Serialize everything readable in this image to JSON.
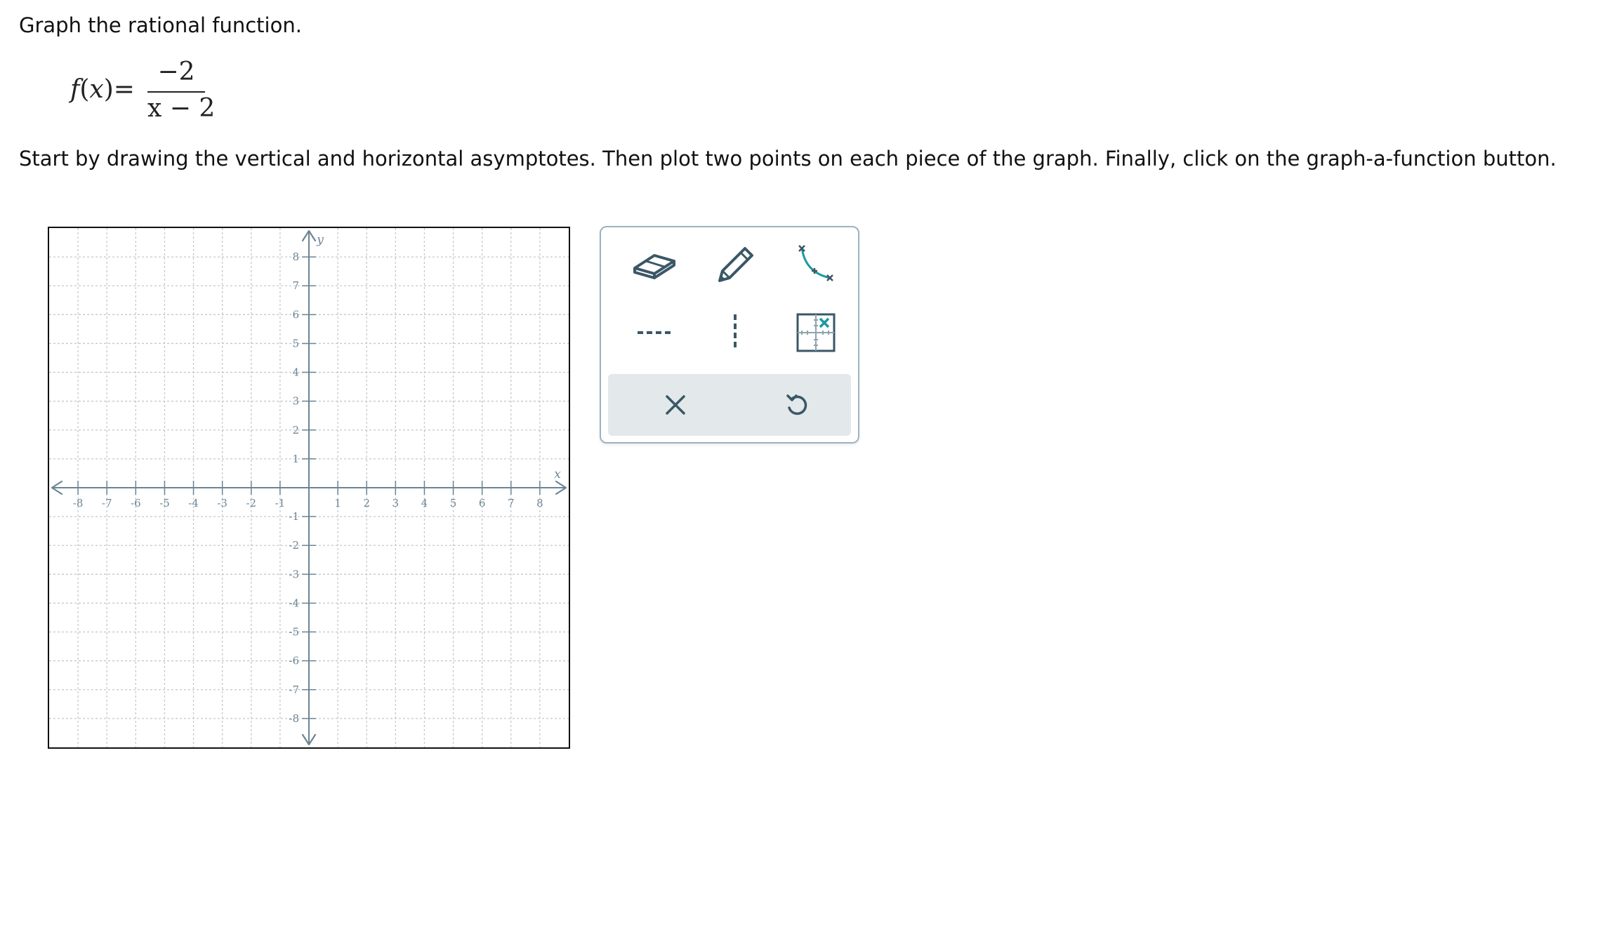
{
  "question": {
    "prompt": "Graph the rational function.",
    "function": {
      "name": "f",
      "variable": "x",
      "equals": "=",
      "numerator": "−2",
      "denominator": "x − 2"
    },
    "directions": "Start by drawing the vertical and horizontal asymptotes. Then plot two points on each piece of the graph. Finally, click on the graph-a-function button."
  },
  "graph": {
    "x_axis_label": "x",
    "y_axis_label": "y",
    "x_range": [
      -9,
      9
    ],
    "y_range": [
      -9,
      9
    ],
    "x_tick_labels": [
      "-8",
      "-7",
      "-6",
      "-5",
      "-4",
      "-3",
      "-2",
      "-1",
      "1",
      "2",
      "3",
      "4",
      "5",
      "6",
      "7",
      "8"
    ],
    "y_tick_labels": [
      "8",
      "7",
      "6",
      "5",
      "4",
      "3",
      "2",
      "1",
      "-1",
      "-2",
      "-3",
      "-4",
      "-5",
      "-6",
      "-7",
      "-8"
    ],
    "grid": true,
    "colors": {
      "axis": "#6c8494",
      "grid": "#c4c9cc",
      "frame": "#111111"
    }
  },
  "toolbar": {
    "tools": [
      {
        "id": "eraser",
        "icon": "eraser-icon"
      },
      {
        "id": "pencil",
        "icon": "pencil-icon"
      },
      {
        "id": "graph-function",
        "icon": "graph-function-icon"
      },
      {
        "id": "horizontal-asymptote",
        "icon": "horizontal-asymptote-icon"
      },
      {
        "id": "vertical-asymptote",
        "icon": "vertical-asymptote-icon"
      },
      {
        "id": "point",
        "icon": "point-plot-icon"
      }
    ],
    "actions": [
      {
        "id": "clear",
        "icon": "close-icon"
      },
      {
        "id": "undo",
        "icon": "undo-icon"
      }
    ],
    "colors": {
      "icon": "#3a5766",
      "accent": "#1a9aa0",
      "border": "#9cb3c0",
      "action_bg": "#e3e8eb"
    }
  }
}
